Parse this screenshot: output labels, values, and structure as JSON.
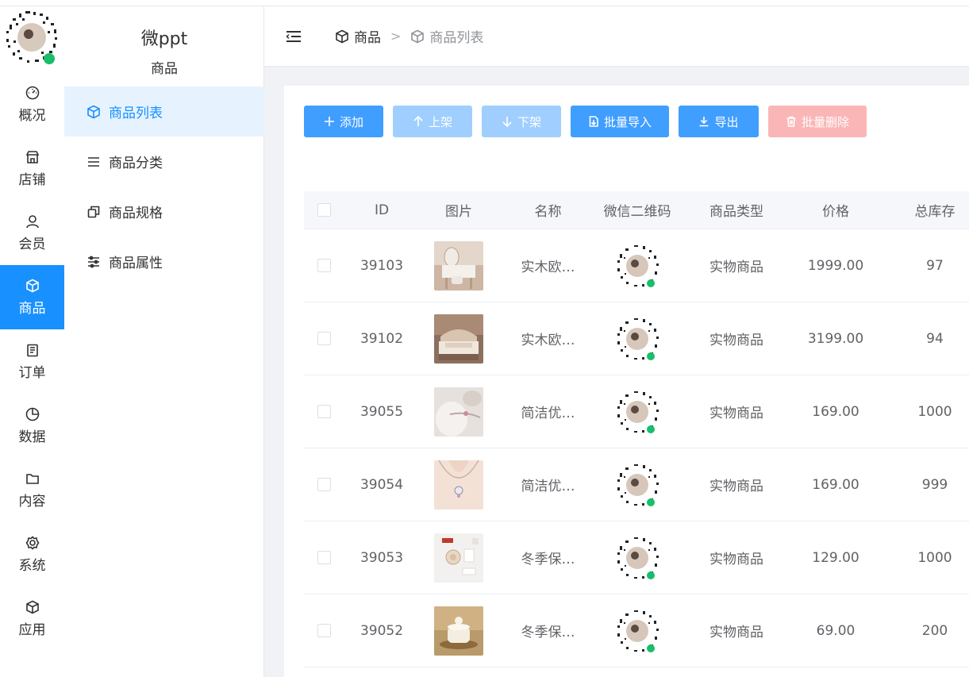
{
  "sidebar": {
    "items": [
      {
        "label": "概况",
        "icon": "dashboard-icon"
      },
      {
        "label": "店铺",
        "icon": "shop-icon"
      },
      {
        "label": "会员",
        "icon": "user-icon"
      },
      {
        "label": "商品",
        "icon": "box-icon",
        "active": true
      },
      {
        "label": "订单",
        "icon": "clipboard-icon"
      },
      {
        "label": "数据",
        "icon": "pie-chart-icon"
      },
      {
        "label": "内容",
        "icon": "folder-icon"
      },
      {
        "label": "系统",
        "icon": "gear-icon"
      },
      {
        "label": "应用",
        "icon": "box-icon"
      }
    ]
  },
  "subnav": {
    "brand": "微ppt",
    "title": "商品",
    "items": [
      {
        "label": "商品列表",
        "icon": "box-icon",
        "active": true
      },
      {
        "label": "商品分类",
        "icon": "list-icon"
      },
      {
        "label": "商品规格",
        "icon": "copy-icon"
      },
      {
        "label": "商品属性",
        "icon": "sliders-icon"
      }
    ]
  },
  "breadcrumb": {
    "items": [
      "商品",
      "商品列表"
    ],
    "separator": ">"
  },
  "toolbar": {
    "add": "添加",
    "up": "上架",
    "down": "下架",
    "import": "批量导入",
    "export": "导出",
    "delete": "批量删除"
  },
  "table": {
    "headers": [
      "ID",
      "图片",
      "名称",
      "微信二维码",
      "商品类型",
      "价格",
      "总库存"
    ],
    "rows": [
      {
        "id": "39103",
        "name": "实木欧…",
        "type": "实物商品",
        "price": "1999.00",
        "stock": "97"
      },
      {
        "id": "39102",
        "name": "实木欧…",
        "type": "实物商品",
        "price": "3199.00",
        "stock": "94"
      },
      {
        "id": "39055",
        "name": "简洁优…",
        "type": "实物商品",
        "price": "169.00",
        "stock": "1000"
      },
      {
        "id": "39054",
        "name": "简洁优…",
        "type": "实物商品",
        "price": "169.00",
        "stock": "999"
      },
      {
        "id": "39053",
        "name": "冬季保…",
        "type": "实物商品",
        "price": "129.00",
        "stock": "1000"
      },
      {
        "id": "39052",
        "name": "冬季保…",
        "type": "实物商品",
        "price": "69.00",
        "stock": "200"
      }
    ]
  },
  "colors": {
    "primary": "#1890ff",
    "button": "#409eff",
    "button_disabled": "#a0cfff",
    "danger_disabled": "#fab6b6"
  }
}
